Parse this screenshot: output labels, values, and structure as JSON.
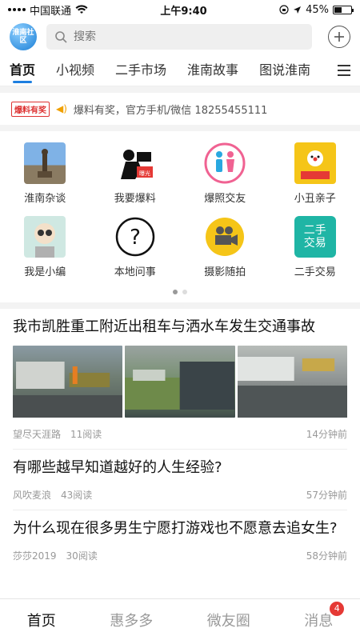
{
  "status": {
    "carrier": "中国联通",
    "time": "上午9:40",
    "battery": "45%",
    "battery_level": 0.45
  },
  "header": {
    "logo_text": "淮南社区",
    "search_placeholder": "搜索"
  },
  "tabs": [
    {
      "label": "首页"
    },
    {
      "label": "小视频"
    },
    {
      "label": "二手市场"
    },
    {
      "label": "淮南故事"
    },
    {
      "label": "图说淮南"
    }
  ],
  "notice": {
    "badge": "爆料有奖",
    "text": "爆料有奖，官方手机/微信 18255455111"
  },
  "grid": [
    {
      "label": "淮南杂谈"
    },
    {
      "label": "我要爆料"
    },
    {
      "label": "爆照交友"
    },
    {
      "label": "小丑亲子"
    },
    {
      "label": "我是小编"
    },
    {
      "label": "本地问事"
    },
    {
      "label": "摄影随拍"
    },
    {
      "label": "二手交易"
    }
  ],
  "articles": [
    {
      "title": "我市凯胜重工附近出租车与洒水车发生交通事故",
      "author": "望尽天涯路",
      "reads": "11阅读",
      "time": "14分钟前"
    },
    {
      "title": "有哪些越早知道越好的人生经验?",
      "author": "风吹麦浪",
      "reads": "43阅读",
      "time": "57分钟前"
    },
    {
      "title": "为什么现在很多男生宁愿打游戏也不愿意去追女生?",
      "author": "莎莎2019",
      "reads": "30阅读",
      "time": "58分钟前"
    }
  ],
  "bottom": {
    "items": [
      {
        "label": "首页"
      },
      {
        "label": "惠多多"
      },
      {
        "label": "微友圈"
      },
      {
        "label": "消息"
      }
    ],
    "badge": "4"
  },
  "colors": {
    "accent": "#1d7fe0",
    "badge": "#e53935"
  }
}
